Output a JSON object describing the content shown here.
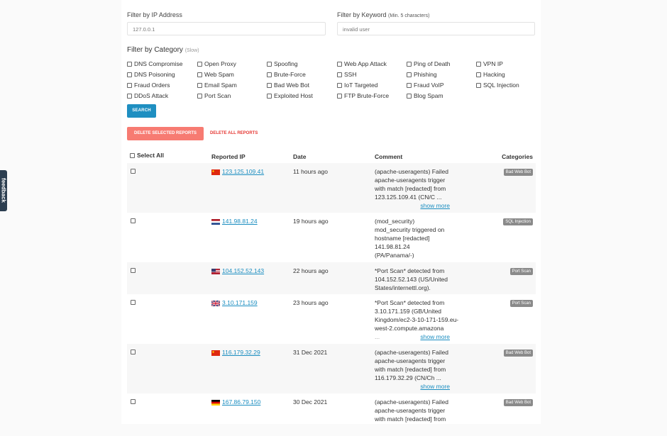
{
  "filters": {
    "ip": {
      "label": "Filter by IP Address",
      "placeholder": "127.0.0.1",
      "value": ""
    },
    "keyword": {
      "label": "Filter by Keyword",
      "hint": "(Min. 5 characters)",
      "placeholder": "invalid user",
      "value": ""
    },
    "category": {
      "label": "Filter by Category",
      "hint": "(Slow)"
    }
  },
  "categories": [
    [
      "DNS Compromise",
      "DNS Poisoning",
      "Fraud Orders",
      "DDoS Attack"
    ],
    [
      "Open Proxy",
      "Web Spam",
      "Email Spam",
      "Port Scan"
    ],
    [
      "Spoofing",
      "Brute-Force",
      "Bad Web Bot",
      "Exploited Host"
    ],
    [
      "Web App Attack",
      "SSH",
      "IoT Targeted",
      "FTP Brute-Force"
    ],
    [
      "Ping of Death",
      "Phishing",
      "Fraud VoIP",
      "Blog Spam"
    ],
    [
      "VPN IP",
      "Hacking",
      "SQL Injection"
    ]
  ],
  "buttons": {
    "search": "SEARCH",
    "delete_selected": "DELETE SELECTED REPORTS",
    "delete_all": "DELETE ALL REPORTS"
  },
  "table": {
    "headers": {
      "select_all": "Select All",
      "ip": "Reported IP",
      "date": "Date",
      "comment": "Comment",
      "categories": "Categories"
    },
    "rows": [
      {
        "flag": "CN",
        "ip": "123.125.109.41",
        "date": "11 hours ago",
        "comment": [
          "(apache-useragents) Failed",
          "apache-useragents trigger",
          "with match [redacted] from",
          "123.125.109.41 (CN/C ..."
        ],
        "show_more": "show more",
        "category": "Bad Web Bot"
      },
      {
        "flag": "NL",
        "ip": "141.98.81.24",
        "date": "19 hours ago",
        "comment": [
          "(mod_security)",
          "mod_security triggered on",
          "hostname [redacted]",
          "141.98.81.24",
          "(PA/Panama/-)"
        ],
        "show_more": "",
        "category": "SQL Injection"
      },
      {
        "flag": "US",
        "ip": "104.152.52.143",
        "date": "22 hours ago",
        "comment": [
          "*Port Scan* detected from",
          "104.152.52.143 (US/United",
          "States/internettl.org)."
        ],
        "show_more": "",
        "category": "Port Scan"
      },
      {
        "flag": "GB",
        "ip": "3.10.171.159",
        "date": "23 hours ago",
        "comment": [
          "*Port Scan* detected from",
          "3.10.171.159 (GB/United",
          "Kingdom/ec2-3-10-171-159.eu-",
          "west-2.compute.amazona"
        ],
        "show_more": "show more",
        "ellipsis": "...",
        "category": "Port Scan"
      },
      {
        "flag": "CN",
        "ip": "116.179.32.29",
        "date": "31 Dec 2021",
        "comment": [
          "(apache-useragents) Failed",
          "apache-useragents trigger",
          "with match [redacted] from",
          "116.179.32.29 (CN/Ch ..."
        ],
        "show_more": "show more",
        "category": "Bad Web Bot"
      },
      {
        "flag": "DE",
        "ip": "167.86.79.150",
        "date": "30 Dec 2021",
        "comment": [
          "(apache-useragents) Failed",
          "apache-useragents trigger",
          "with match [redacted] from"
        ],
        "show_more": "",
        "category": "Bad Web Bot"
      }
    ]
  },
  "feedback": {
    "label": "feedback"
  },
  "colors": {
    "primary": "#1f8fc1",
    "danger_light": "#f77b72",
    "danger": "#e53935",
    "link": "#1a8dc0",
    "badge": "#8a8a8a"
  }
}
